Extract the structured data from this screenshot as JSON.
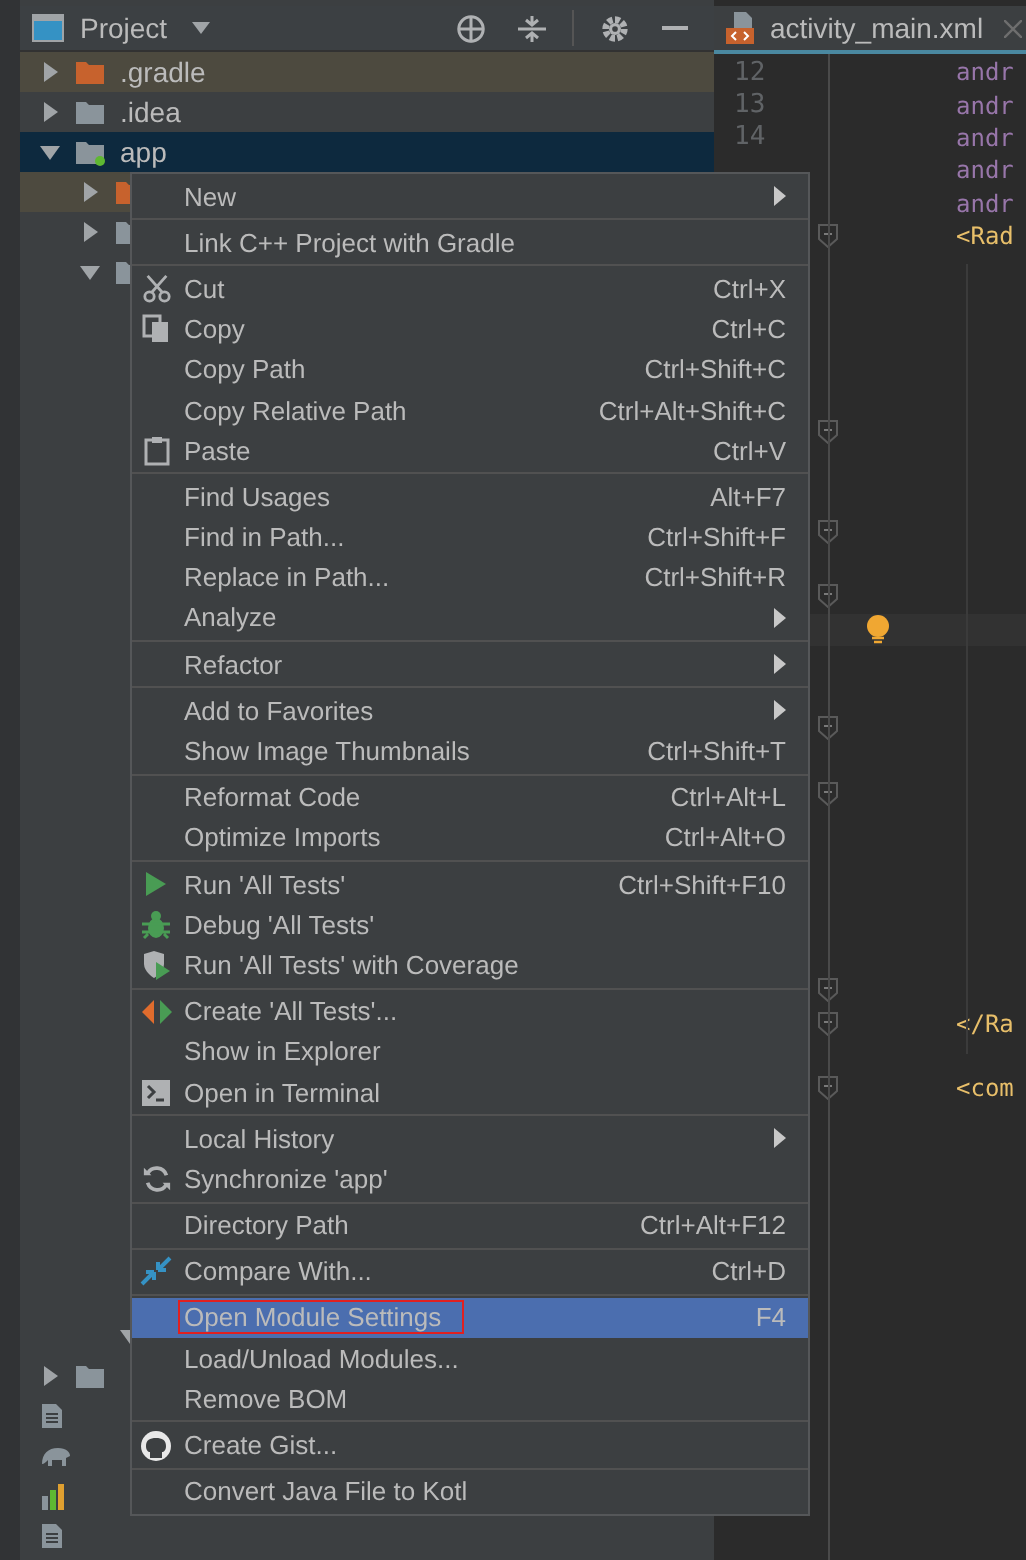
{
  "panel": {
    "title": "Project"
  },
  "tree": [
    {
      "label": ".gradle",
      "kind": "excluded-folder",
      "expanded": false,
      "selected": false
    },
    {
      "label": ".idea",
      "kind": "folder",
      "expanded": false,
      "selected": false
    },
    {
      "label": "app",
      "kind": "module",
      "expanded": true,
      "selected": true,
      "children": [
        {
          "kind": "excluded-folder",
          "expanded": false,
          "selected": false
        },
        {
          "kind": "folder",
          "expanded": false,
          "selected": false
        },
        {
          "kind": "folder",
          "expanded": true,
          "selected": false,
          "children": [
            {
              "expanded": true,
              "selected": false
            }
          ]
        }
      ]
    },
    {
      "kind": "folder",
      "expanded": false,
      "selected": false
    },
    {
      "kind": "file",
      "selected": false
    },
    {
      "kind": "gradle-file",
      "selected": false
    },
    {
      "kind": "chart-file",
      "selected": false
    },
    {
      "kind": "file",
      "selected": false
    }
  ],
  "editor": {
    "tab": {
      "label": "activity_main.xml"
    },
    "lines": [
      {
        "number": "12",
        "code": "andr",
        "kind": "attribute"
      },
      {
        "number": "13",
        "code": "andr",
        "kind": "attribute"
      },
      {
        "number": "14",
        "code": "andr",
        "kind": "attribute"
      },
      {
        "code": "andr",
        "kind": "attribute"
      },
      {
        "code": "andr",
        "kind": "attribute"
      },
      {
        "code": "<Rad",
        "kind": "tag"
      },
      {
        "code": "</Ra",
        "kind": "tag"
      },
      {
        "code": "<com",
        "kind": "tag"
      }
    ]
  },
  "menu": {
    "sections": [
      {
        "items": [
          {
            "label": "New",
            "submenu": true,
            "selected": false
          }
        ]
      },
      {
        "items": [
          {
            "label": "Link C++ Project with Gradle",
            "selected": false
          }
        ]
      },
      {
        "items": [
          {
            "label": "Cut",
            "shortcut": "Ctrl+X",
            "kind": "cut",
            "selected": false
          },
          {
            "label": "Copy",
            "shortcut": "Ctrl+C",
            "kind": "copy",
            "selected": false
          },
          {
            "label": "Copy Path",
            "shortcut": "Ctrl+Shift+C",
            "selected": false
          },
          {
            "label": "Copy Relative Path",
            "shortcut": "Ctrl+Alt+Shift+C",
            "selected": false
          },
          {
            "label": "Paste",
            "shortcut": "Ctrl+V",
            "kind": "paste",
            "selected": false
          }
        ]
      },
      {
        "items": [
          {
            "label": "Find Usages",
            "shortcut": "Alt+F7",
            "selected": false
          },
          {
            "label": "Find in Path...",
            "shortcut": "Ctrl+Shift+F",
            "selected": false
          },
          {
            "label": "Replace in Path...",
            "shortcut": "Ctrl+Shift+R",
            "selected": false
          },
          {
            "label": "Analyze",
            "submenu": true,
            "selected": false
          }
        ]
      },
      {
        "items": [
          {
            "label": "Refactor",
            "submenu": true,
            "selected": false
          }
        ]
      },
      {
        "items": [
          {
            "label": "Add to Favorites",
            "submenu": true,
            "selected": false
          },
          {
            "label": "Show Image Thumbnails",
            "shortcut": "Ctrl+Shift+T",
            "selected": false
          }
        ]
      },
      {
        "items": [
          {
            "label": "Reformat Code",
            "shortcut": "Ctrl+Alt+L",
            "selected": false
          },
          {
            "label": "Optimize Imports",
            "shortcut": "Ctrl+Alt+O",
            "selected": false
          }
        ]
      },
      {
        "items": [
          {
            "label": "Run 'All Tests'",
            "shortcut": "Ctrl+Shift+F10",
            "kind": "run",
            "selected": false
          },
          {
            "label": "Debug 'All Tests'",
            "kind": "debug",
            "selected": false
          },
          {
            "label": "Run 'All Tests' with Coverage",
            "kind": "coverage",
            "selected": false
          }
        ]
      },
      {
        "items": [
          {
            "label": "Create 'All Tests'...",
            "kind": "create",
            "selected": false
          },
          {
            "label": "Show in Explorer",
            "selected": false
          },
          {
            "label": "Open in Terminal",
            "kind": "terminal",
            "selected": false
          }
        ]
      },
      {
        "items": [
          {
            "label": "Local History",
            "submenu": true,
            "selected": false
          },
          {
            "label": "Synchronize 'app'",
            "kind": "sync",
            "selected": false
          }
        ]
      },
      {
        "items": [
          {
            "label": "Directory Path",
            "shortcut": "Ctrl+Alt+F12",
            "selected": false
          }
        ]
      },
      {
        "items": [
          {
            "label": "Compare With...",
            "shortcut": "Ctrl+D",
            "kind": "compare",
            "selected": false
          }
        ]
      },
      {
        "items": [
          {
            "label": "Open Module Settings",
            "shortcut": "F4",
            "selected": true,
            "annotated": true
          },
          {
            "label": "Load/Unload Modules...",
            "selected": false
          },
          {
            "label": "Remove BOM",
            "selected": false
          }
        ]
      },
      {
        "items": [
          {
            "label": "Create Gist...",
            "kind": "github",
            "selected": false
          }
        ]
      },
      {
        "items": [
          {
            "label": "Convert Java File to Kotl",
            "selected": false
          }
        ]
      }
    ]
  }
}
